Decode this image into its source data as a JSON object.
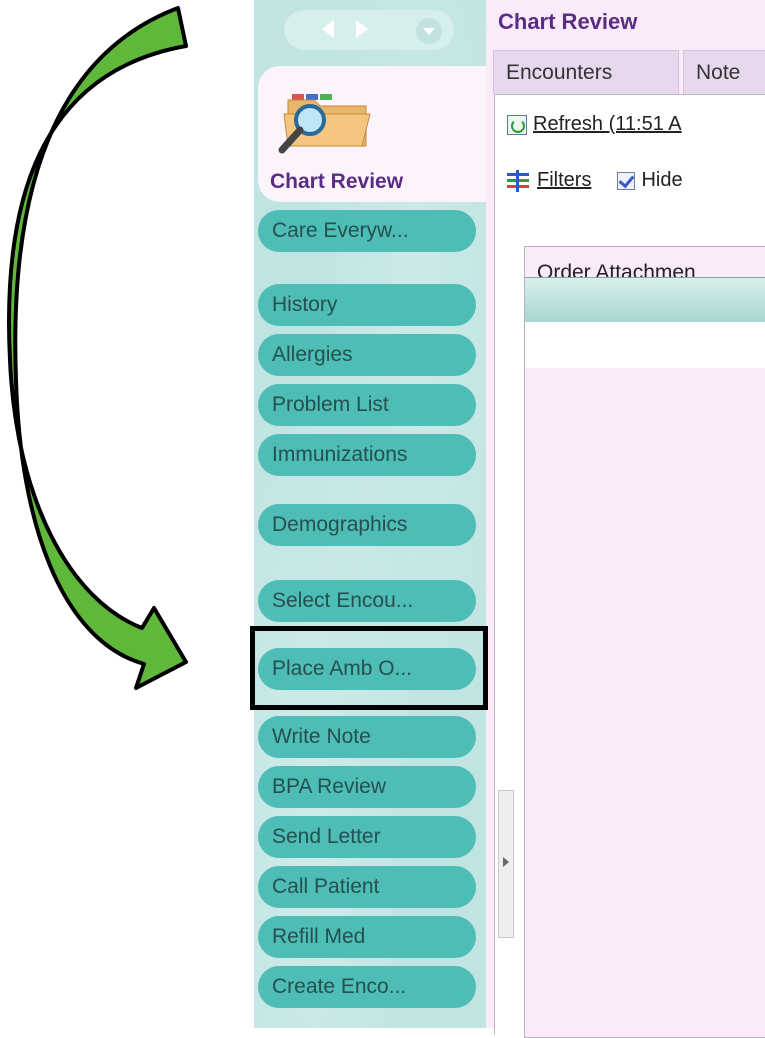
{
  "main": {
    "title": "Chart Review",
    "tabs": [
      {
        "label": "Encounters"
      },
      {
        "label": "Note"
      }
    ],
    "toolbar": {
      "refresh_label": "Refresh (11:51 A",
      "filters_label": "Filters",
      "hide_label": "Hide"
    },
    "panel": {
      "title": "Order Attachmen"
    }
  },
  "sidebar": {
    "active": {
      "label": "Chart Review"
    },
    "buttons": [
      {
        "label": "Care Everyw..."
      },
      {
        "label": "History"
      },
      {
        "label": "Allergies"
      },
      {
        "label": "Problem List"
      },
      {
        "label": "Immunizations"
      },
      {
        "label": "Demographics"
      },
      {
        "label": "Select Encou..."
      },
      {
        "label": "Place Amb O..."
      },
      {
        "label": "Write Note"
      },
      {
        "label": "BPA Review"
      },
      {
        "label": "Send Letter"
      },
      {
        "label": "Call Patient"
      },
      {
        "label": "Refill Med"
      },
      {
        "label": "Create Enco..."
      }
    ]
  },
  "colors": {
    "arrow_fill": "#5fb83a",
    "sidebar_bg": "#bfe4e2",
    "sidebar_button": "#4dbdb5",
    "active_text": "#5a2d84",
    "main_bg": "#fbeafa",
    "highlight_border": "#000000"
  },
  "icons": [
    "back-arrow-icon",
    "forward-arrow-icon",
    "menu-chevron-icon",
    "folder-magnifier-icon",
    "refresh-icon",
    "filter-icon",
    "checkbox-icon",
    "expand-arrow-icon"
  ]
}
